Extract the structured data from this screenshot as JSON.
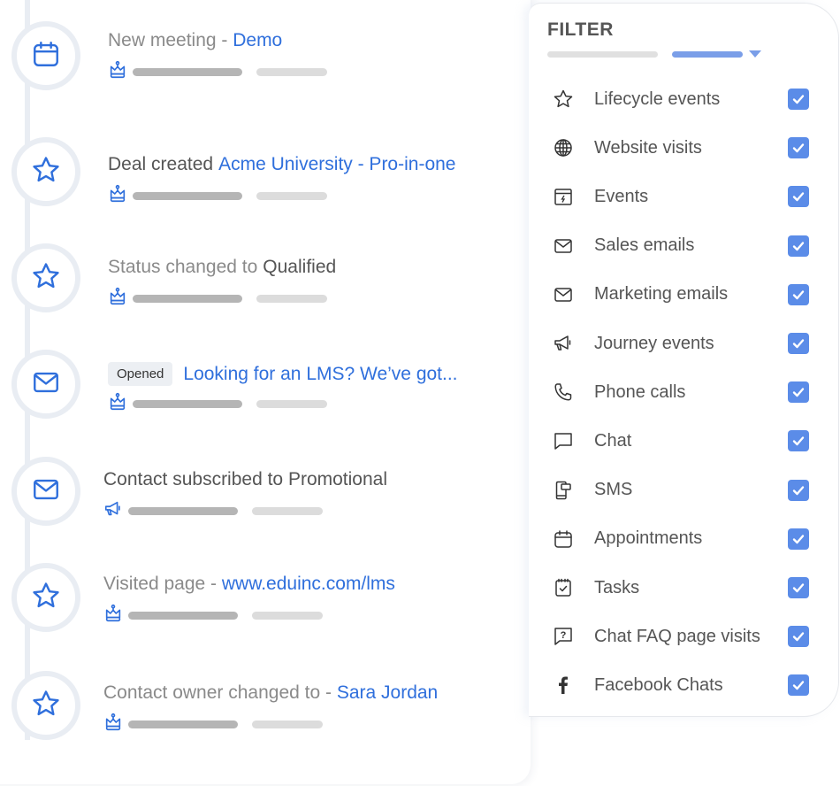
{
  "colors": {
    "accent": "#2f6fdc",
    "checkbox": "#5b8ce8",
    "timeline_ring": "#e9edf3"
  },
  "timeline": [
    {
      "icon": "calendar-icon",
      "badge": "",
      "prefix": "New meeting - ",
      "prefix_style": "muted",
      "link": "Demo",
      "meta_icon": "crown-icon"
    },
    {
      "icon": "star-icon",
      "badge": "",
      "prefix": "Deal created",
      "prefix_style": "dark",
      "link": "Acme University - Pro-in-one",
      "meta_icon": "crown-icon"
    },
    {
      "icon": "star-icon",
      "badge": "",
      "prefix": "Status changed to",
      "prefix_style": "muted",
      "value": "Qualified",
      "meta_icon": "crown-icon"
    },
    {
      "icon": "mail-icon",
      "badge": "Opened",
      "prefix": "",
      "prefix_style": "muted",
      "link": "Looking for an LMS? We’ve got...",
      "meta_icon": "crown-icon"
    },
    {
      "icon": "mail-icon",
      "badge": "",
      "prefix": "Contact subscribed to Promotional",
      "prefix_style": "dark",
      "meta_icon": "megaphone-icon"
    },
    {
      "icon": "star-icon",
      "badge": "",
      "prefix": "Visited page - ",
      "prefix_style": "muted",
      "link": "www.eduinc.com/lms",
      "meta_icon": "crown-icon"
    },
    {
      "icon": "star-icon",
      "badge": "",
      "prefix": "Contact owner changed to - ",
      "prefix_style": "muted",
      "link": "Sara Jordan",
      "meta_icon": "crown-icon"
    }
  ],
  "filter": {
    "title": "FILTER",
    "items": [
      {
        "icon": "star-icon",
        "label": "Lifecycle events",
        "checked": true
      },
      {
        "icon": "globe-icon",
        "label": "Website visits",
        "checked": true
      },
      {
        "icon": "event-calendar-icon",
        "label": "Events",
        "checked": true
      },
      {
        "icon": "mail-icon",
        "label": "Sales emails",
        "checked": true
      },
      {
        "icon": "mail-icon",
        "label": "Marketing emails",
        "checked": true
      },
      {
        "icon": "megaphone-icon",
        "label": "Journey events",
        "checked": true
      },
      {
        "icon": "phone-icon",
        "label": "Phone calls",
        "checked": true
      },
      {
        "icon": "chat-bubble-icon",
        "label": "Chat",
        "checked": true
      },
      {
        "icon": "sms-icon",
        "label": "SMS",
        "checked": true
      },
      {
        "icon": "calendar-icon",
        "label": "Appointments",
        "checked": true
      },
      {
        "icon": "task-icon",
        "label": "Tasks",
        "checked": true
      },
      {
        "icon": "chat-question-icon",
        "label": "Chat FAQ page visits",
        "checked": true
      },
      {
        "icon": "facebook-icon",
        "label": "Facebook Chats",
        "checked": true
      }
    ]
  }
}
